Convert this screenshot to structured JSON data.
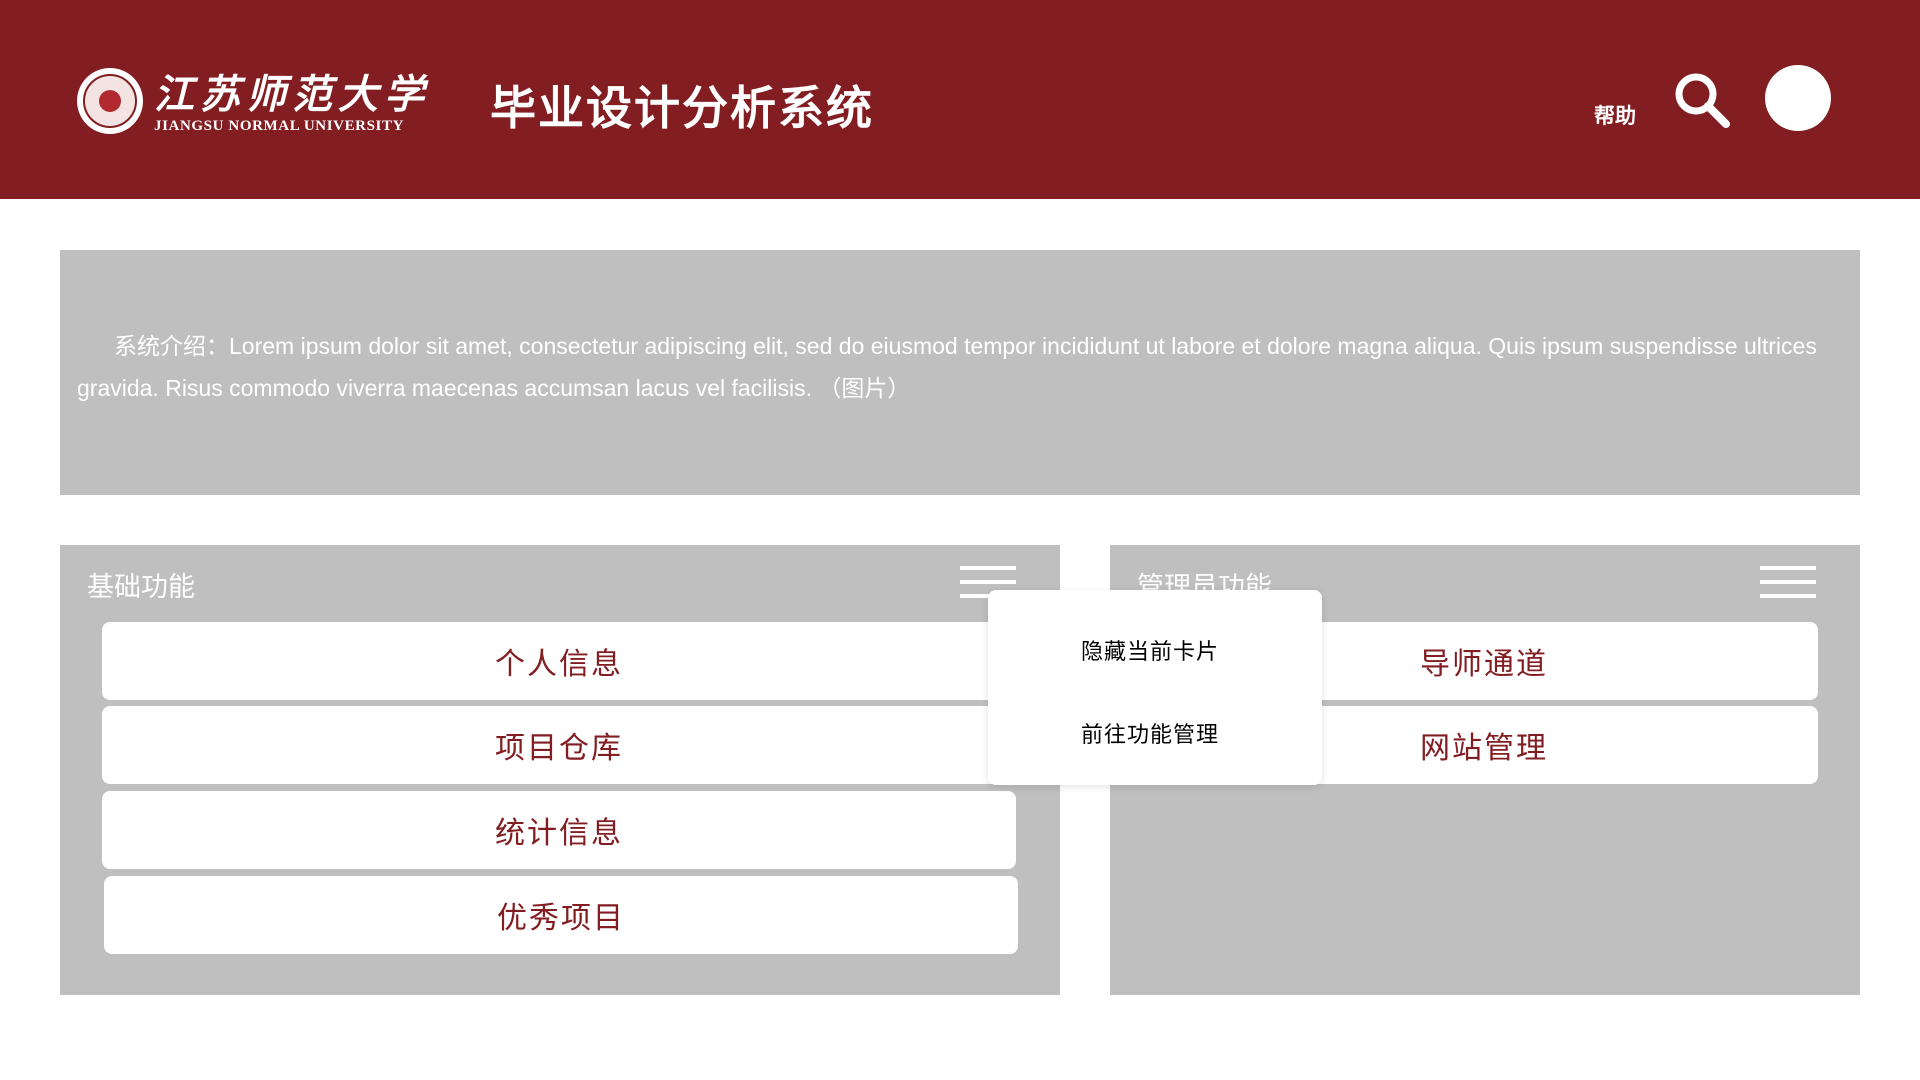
{
  "header": {
    "logo_cn": "江苏师范大学",
    "logo_en": "JIANGSU NORMAL UNIVERSITY",
    "app_title": "毕业设计分析系统",
    "help_label": "帮助",
    "search_icon": "search-icon",
    "avatar": "user-avatar",
    "bg_color": "#821D21"
  },
  "intro": {
    "text": "系统介绍：Lorem ipsum dolor sit amet, consectetur adipiscing elit, sed do eiusmod tempor incididunt ut labore et dolore magna aliqua. Quis ipsum suspendisse ultrices gravida. Risus commodo viverra maecenas accumsan lacus vel facilisis. （图片）"
  },
  "cards": {
    "basic": {
      "title": "基础功能",
      "menu_icon": "hamburger-menu-icon",
      "items": [
        "个人信息",
        "项目仓库",
        "统计信息",
        "优秀项目"
      ]
    },
    "admin": {
      "title": "管理员功能",
      "menu_icon": "hamburger-menu-icon",
      "items": [
        "导师通道",
        "网站管理"
      ]
    }
  },
  "popover": {
    "items": [
      "隐藏当前卡片",
      "前往功能管理"
    ]
  },
  "colors": {
    "accent": "#821D21",
    "card_bg": "#BFBFBF",
    "white": "#FFFFFF"
  }
}
